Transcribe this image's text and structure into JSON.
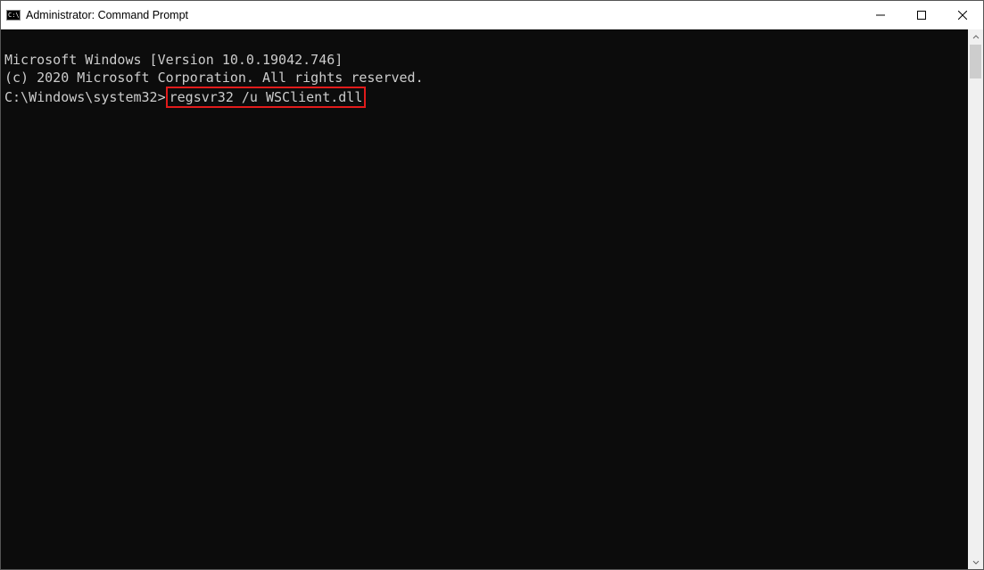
{
  "titlebar": {
    "title": "Administrator: Command Prompt"
  },
  "terminal": {
    "line1": "Microsoft Windows [Version 10.0.19042.746]",
    "line2": "(c) 2020 Microsoft Corporation. All rights reserved.",
    "blank": "",
    "prompt_path": "C:\\Windows\\system32>",
    "command": "regsvr32 /u WSClient.dll"
  },
  "highlight": {
    "color": "#e11b1b"
  }
}
